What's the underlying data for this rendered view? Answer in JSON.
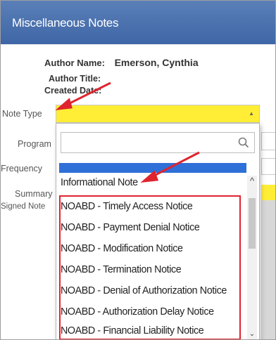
{
  "window": {
    "title": "Miscellaneous Notes"
  },
  "author": {
    "name_label": "Author Name:",
    "name_value": "Emerson, Cynthia",
    "title_label": "Author Title:",
    "created_label": "Created Date:"
  },
  "fields": {
    "note_type": "Note Type",
    "program": "Program",
    "frequency": "Frequency",
    "summary": "Summary",
    "signed_note": "Signed Note"
  },
  "dropdown": {
    "search_placeholder": "",
    "options": [
      "Informational Note",
      "NOABD - Timely Access Notice",
      "NOABD - Payment Denial Notice",
      "NOABD - Modification Notice",
      "NOABD - Termination Notice",
      "NOABD - Denial of Authorization Notice",
      "NOABD - Authorization Delay Notice",
      "NOABD - Financial Liability Notice"
    ]
  },
  "colors": {
    "title_bar": "#4a71b0",
    "required_field": "#ffee35",
    "selected_option": "#2f6fd8",
    "annotation_red": "#e0242e"
  }
}
